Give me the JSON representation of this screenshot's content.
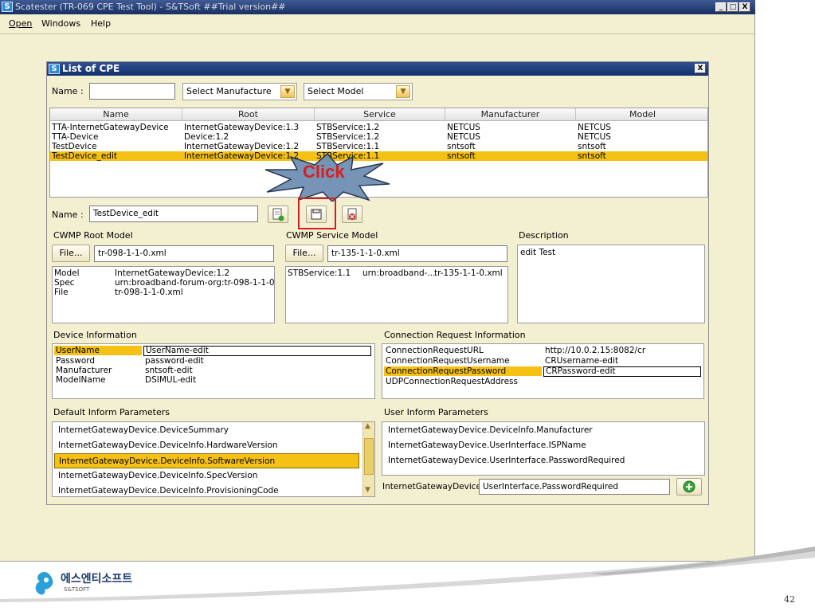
{
  "app": {
    "title": "Scatester (TR-069 CPE Test Tool) - S&TSoft ##Trial version##",
    "icon_letter": "S",
    "window_buttons": [
      "_",
      "□",
      "X"
    ],
    "menu": [
      "Open",
      "Windows",
      "Help"
    ]
  },
  "dialog": {
    "title": "List of CPE",
    "close_label": "X",
    "filter": {
      "name_label": "Name :",
      "name_value": "",
      "manufacture_select": "Select Manufacture",
      "model_select": "Select Model"
    },
    "cpe_table": {
      "columns": [
        "Name",
        "Root",
        "Service",
        "Manufacturer",
        "Model"
      ],
      "rows": [
        [
          "TTA-InternetGatewayDevice",
          "InternetGatewayDevice:1.3",
          "STBService:1.2",
          "NETCUS",
          "NETCUS"
        ],
        [
          "TTA-Device",
          "Device:1.2",
          "STBService:1.2",
          "NETCUS",
          "NETCUS"
        ],
        [
          "TestDevice",
          "InternetGatewayDevice:1.2",
          "STBService:1.1",
          "sntsoft",
          "sntsoft"
        ],
        [
          "TestDevice_edit",
          "InternetGatewayDevice:1.2",
          "STBService:1.1",
          "sntsoft",
          "sntsoft"
        ]
      ],
      "selected_row": 3
    },
    "callout_text": "Click",
    "edit": {
      "name_label": "Name :",
      "name_value": "TestDevice_edit",
      "icons": [
        "add-document-icon",
        "save-icon",
        "delete-document-icon"
      ]
    },
    "cwmp_root": {
      "label": "CWMP Root Model",
      "file_button": "File...",
      "file_value": "tr-098-1-1-0.xml",
      "rows": [
        [
          "Model",
          "InternetGatewayDevice:1.2"
        ],
        [
          "Spec",
          "urn:broadband-forum-org:tr-098-1-1-0"
        ],
        [
          "File",
          "tr-098-1-1-0.xml"
        ]
      ]
    },
    "cwmp_service": {
      "label": "CWMP Service Model",
      "file_button": "File...",
      "file_value": "tr-135-1-1-0.xml",
      "row": [
        "STBService:1.1",
        "urn:broadband-...",
        "tr-135-1-1-0.xml"
      ]
    },
    "description": {
      "label": "Description",
      "value": "edit Test"
    },
    "device_info": {
      "label": "Device Information",
      "rows": [
        [
          "UserName",
          "UserName-edit"
        ],
        [
          "Password",
          "password-edit"
        ],
        [
          "Manufacturer",
          "sntsoft-edit"
        ],
        [
          "ModelName",
          "DSIMUL-edit"
        ]
      ]
    },
    "connection_request": {
      "label": "Connection Request Information",
      "rows": [
        [
          "ConnectionRequestURL",
          "http://10.0.2.15:8082/cr"
        ],
        [
          "ConnectionRequestUsername",
          "CRUsername-edit"
        ],
        [
          "ConnectionRequestPassword",
          "CRPassword-edit"
        ],
        [
          "UDPConnectionRequestAddress",
          ""
        ]
      ]
    },
    "default_inform": {
      "label": "Default Inform Parameters",
      "items": [
        "InternetGatewayDevice.DeviceSummary",
        "InternetGatewayDevice.DeviceInfo.HardwareVersion",
        "InternetGatewayDevice.DeviceInfo.SoftwareVersion",
        "InternetGatewayDevice.DeviceInfo.SpecVersion",
        "InternetGatewayDevice.DeviceInfo.ProvisioningCode"
      ],
      "selected_index": 2
    },
    "user_inform": {
      "label": "User Inform Parameters",
      "items": [
        "InternetGatewayDevice.DeviceInfo.Manufacturer",
        "InternetGatewayDevice.UserInterface.ISPName",
        "InternetGatewayDevice.UserInterface.PasswordRequired"
      ],
      "prefix": "InternetGatewayDevice.",
      "input_value": "UserInterface.PasswordRequired"
    }
  },
  "footer": {
    "company_korean": "에스엔티소프트",
    "company_english": "S&TSOFT",
    "page_number": "42"
  },
  "colors": {
    "window_bg": "#f3efd1",
    "selection": "#f5c114",
    "titlebar": "#182f63",
    "callout": "#6f8fb3",
    "callout_text": "#d42020"
  }
}
